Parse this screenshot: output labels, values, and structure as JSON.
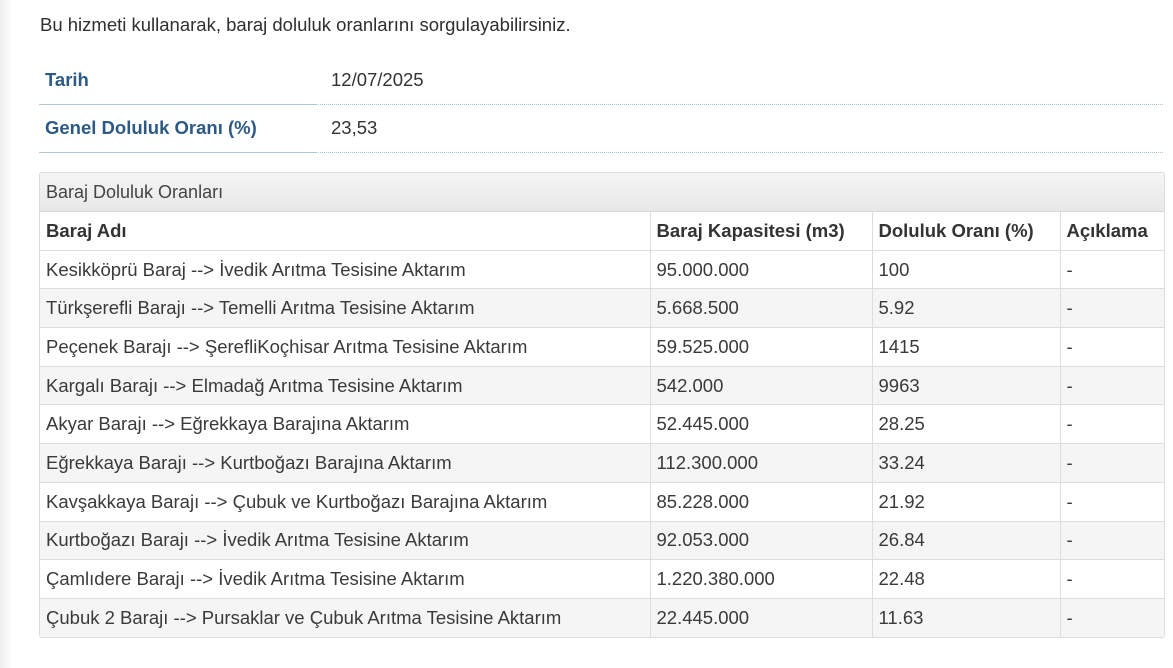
{
  "intro_text": "Bu hizmeti kullanarak, baraj doluluk oranlarını sorgulayabilirsiniz.",
  "info": {
    "date_label": "Tarih",
    "date_value": "12/07/2025",
    "fill_label": "Genel Doluluk Oranı (%)",
    "fill_value": "23,53"
  },
  "panel": {
    "title": "Baraj Doluluk Oranları",
    "columns": [
      "Baraj Adı",
      "Baraj Kapasitesi (m3)",
      "Doluluk Oranı (%)",
      "Açıklama"
    ],
    "rows": [
      {
        "name": "Kesikköprü Baraj --> İvedik Arıtma Tesisine Aktarım",
        "capacity": "95.000.000",
        "rate": "100",
        "note": "-"
      },
      {
        "name": "Türkşerefli Barajı --> Temelli Arıtma Tesisine Aktarım",
        "capacity": "5.668.500",
        "rate": "5.92",
        "note": "-"
      },
      {
        "name": "Peçenek Barajı --> ŞerefliKoçhisar Arıtma Tesisine Aktarım",
        "capacity": "59.525.000",
        "rate": "1415",
        "note": "-"
      },
      {
        "name": "Kargalı Barajı --> Elmadağ Arıtma Tesisine Aktarım",
        "capacity": "542.000",
        "rate": "9963",
        "note": "-"
      },
      {
        "name": "Akyar Barajı --> Eğrekkaya Barajına Aktarım",
        "capacity": "52.445.000",
        "rate": "28.25",
        "note": "-"
      },
      {
        "name": "Eğrekkaya Barajı --> Kurtboğazı Barajına Aktarım",
        "capacity": "112.300.000",
        "rate": "33.24",
        "note": "-"
      },
      {
        "name": "Kavşakkaya Barajı --> Çubuk ve Kurtboğazı Barajına Aktarım",
        "capacity": "85.228.000",
        "rate": "21.92",
        "note": "-"
      },
      {
        "name": "Kurtboğazı Barajı --> İvedik Arıtma Tesisine Aktarım",
        "capacity": "92.053.000",
        "rate": "26.84",
        "note": "-"
      },
      {
        "name": "Çamlıdere Barajı --> İvedik Arıtma Tesisine Aktarım",
        "capacity": "1.220.380.000",
        "rate": "22.48",
        "note": "-"
      },
      {
        "name": "Çubuk 2 Barajı --> Pursaklar ve Çubuk Arıtma Tesisine Aktarım",
        "capacity": "22.445.000",
        "rate": "11.63",
        "note": "-"
      }
    ]
  }
}
